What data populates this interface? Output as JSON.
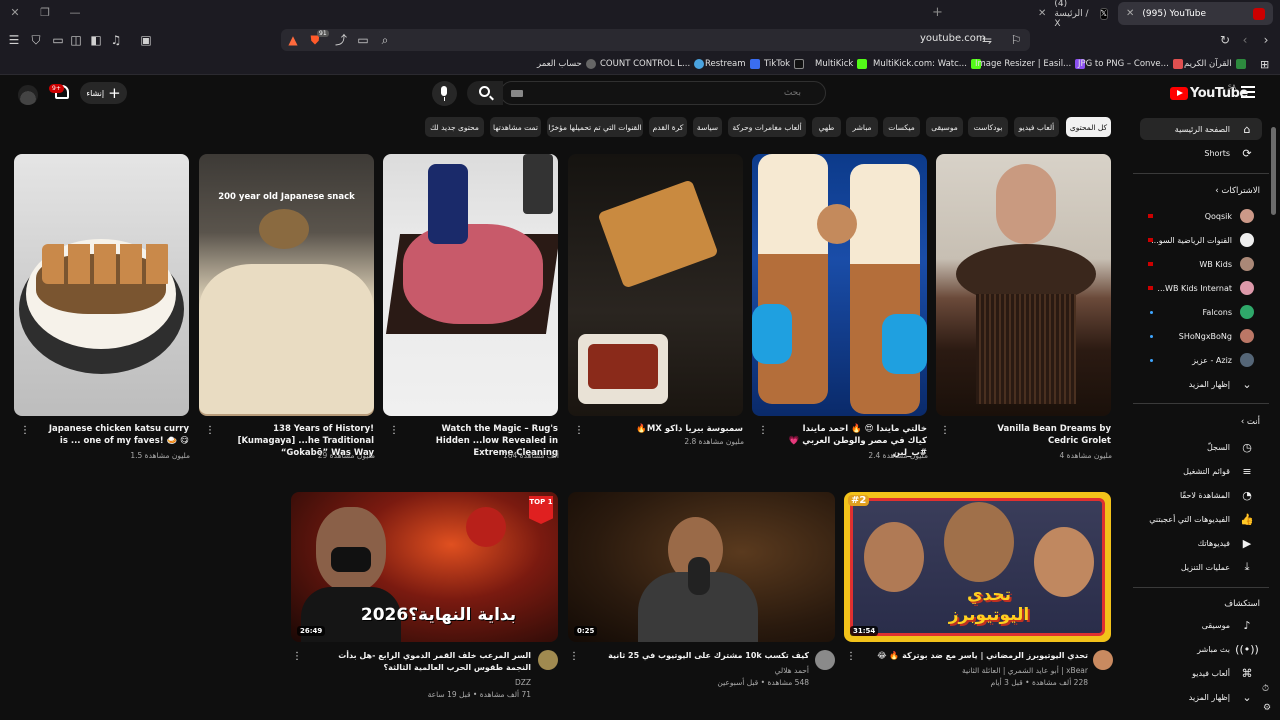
{
  "browser": {
    "tabs": [
      {
        "title": "(995) YouTube"
      },
      {
        "title": "(4) الرئيسة / X"
      }
    ],
    "url": "youtube.com",
    "bookmarks": [
      {
        "label": "حساب العمر"
      },
      {
        "label": "COUNT CONTROL L..."
      },
      {
        "label": "Restream"
      },
      {
        "label": "TikTok"
      },
      {
        "label": "MultiKick"
      },
      {
        "label": "MultiKick.com: Watc..."
      },
      {
        "label": "Image Resizer | Easil..."
      },
      {
        "label": "JPG to PNG – Conve..."
      },
      {
        "label": "القرآن الكريم"
      }
    ],
    "shield_count": "91"
  },
  "masthead": {
    "logo_text": "YouTube",
    "country_code": "SA",
    "search_placeholder": "بحث",
    "create_label": "إنشاء",
    "notif_count": "9+"
  },
  "chips": [
    {
      "label": "كل المحتوى"
    },
    {
      "label": "ألعاب فيديو"
    },
    {
      "label": "بودكاست"
    },
    {
      "label": "موسيقى"
    },
    {
      "label": "ميكسات"
    },
    {
      "label": "مباشر"
    },
    {
      "label": "طهي"
    },
    {
      "label": "ألعاب مغامرات وحركة"
    },
    {
      "label": "سياسة"
    },
    {
      "label": "كرة القدم"
    },
    {
      "label": "القنوات التي تم تحميلها مؤخرًا"
    },
    {
      "label": "تمت مشاهدتها"
    },
    {
      "label": "محتوى جديد لك"
    }
  ],
  "sidebar": {
    "home": "الصفحة الرئيسية",
    "shorts": "Shorts",
    "subs_heading": "الاشتراكات",
    "subs": [
      {
        "label": "Qoqsik"
      },
      {
        "label": "القنوات الرياضية السو..."
      },
      {
        "label": "WB Kids"
      },
      {
        "label": "WB Kids Internat..."
      },
      {
        "label": "Falcons"
      },
      {
        "label": "SHoNgxBoNg"
      },
      {
        "label": "Aziz - عزيز"
      }
    ],
    "show_more": "إظهار المزيد",
    "you_heading": "أنت",
    "you": [
      {
        "label": "السجلّ"
      },
      {
        "label": "قوائم التشغيل"
      },
      {
        "label": "المشاهدة لاحقًا"
      },
      {
        "label": "الفيديوهات التي أعجبتني"
      },
      {
        "label": "فيديوهاتك"
      },
      {
        "label": "عمليات التنزيل"
      }
    ],
    "explore_heading": "استكشاف",
    "explore": [
      {
        "label": "موسيقى"
      },
      {
        "label": "بث مباشر"
      },
      {
        "label": "ألعاب فيديو"
      }
    ],
    "show_more_2": "إظهار المزيد"
  },
  "shorts": [
    {
      "title": "Vanilla Bean Dreams by Cedric Grolet",
      "views": "4 مليون مشاهدة"
    },
    {
      "title": "خالتي مايندا 😍 🔥 احمد مايندا كياك في مصر والوطن العربي 💗 #ب_لبن",
      "views": "2.4 مليون مشاهدة"
    },
    {
      "title": "سمبوسة بيريا داكو MX🔥",
      "views": "2.8 مليون مشاهدة"
    },
    {
      "title": "Watch the Magic – Rug's Hidden ...low Revealed in Extreme Cleaning",
      "views": "164 ألف مشاهدة"
    },
    {
      "title": "138 Years of History! [Kumagaya] ...he Traditional “Gokabō” Was Way",
      "views": "29 مليون مشاهدة"
    },
    {
      "title": "Japanese chicken katsu curry is ... one of my faves! 🍛 😋",
      "views": "1.5 مليون مشاهدة"
    }
  ],
  "short_overlays": {
    "japanese_snack": "200 year old Japanese snack"
  },
  "videos": [
    {
      "title": "تحدي اليوتيوبرز الرمضاني | ياسر مع ضد بوتركة 🔥 😂",
      "channel": "xBear | أبو عايد الشمري | العائلة الثانية",
      "meta": "228 ألف مشاهدة • قبل 3 أيام",
      "duration": "31:54",
      "overlay": "تحدي اليوتيوبرز",
      "badge": "#2"
    },
    {
      "title": "كيف تكسب 10k مشترك على اليوتيوب في 25 ثانية",
      "channel": "أحمد هلالي",
      "meta": "548 مشاهدة • قبل أسبوعين",
      "duration": "0:25"
    },
    {
      "title": "السر المرعب خلف القمر الدموي الرابع -هل بدأت النجمة طقوس الحرب العالمية الثالثة؟",
      "channel": "DZZ",
      "meta": "71 ألف مشاهدة • قبل 19 ساعة",
      "duration": "26:49",
      "overlay": "بداية النهاية؟2026",
      "badge": "TOP 1"
    }
  ],
  "colors": {
    "background": "#0f0f0f",
    "brand_red": "#ff0000",
    "chip_bg": "#272727",
    "text_secondary": "#aaaaaa"
  }
}
